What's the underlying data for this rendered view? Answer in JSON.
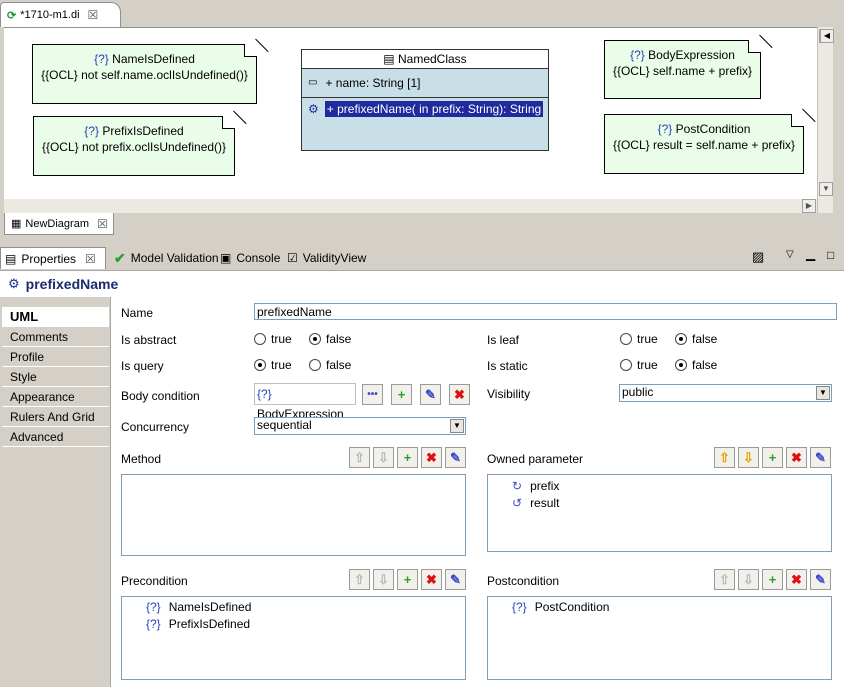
{
  "editor": {
    "tab_label": "*1710-m1.di"
  },
  "diagram": {
    "notes": [
      {
        "title": "NameIsDefined",
        "body": "{{OCL} not self.name.oclIsUndefined()}"
      },
      {
        "title": "PrefixIsDefined",
        "body": "{{OCL} not prefix.oclIsUndefined()}"
      },
      {
        "title": "BodyExpression",
        "body": "{{OCL} self.name + prefix}"
      },
      {
        "title": "PostCondition",
        "body": "{{OCL} result = self.name + prefix}"
      }
    ],
    "class_name": "NamedClass",
    "attribute": "+ name: String [1]",
    "operation": "+ prefixedName(  in prefix: String): String",
    "note_marker": "{?}"
  },
  "diagram_tab": "NewDiagram",
  "views": {
    "properties": "Properties",
    "validation": "Model Validation",
    "console": "Console",
    "validity": "ValidityView"
  },
  "title": "prefixedName",
  "sidebar": [
    "UML",
    "Comments",
    "Profile",
    "Style",
    "Appearance",
    "Rulers And Grid",
    "Advanced"
  ],
  "form": {
    "name_label": "Name",
    "name_value": "prefixedName",
    "is_abstract": "Is abstract",
    "is_leaf": "Is leaf",
    "is_query": "Is query",
    "is_static": "Is static",
    "true": "true",
    "false": "false",
    "body_condition": "Body condition",
    "body_value": "BodyExpression",
    "body_marker": "{?}",
    "visibility": "Visibility",
    "visibility_value": "public",
    "concurrency": "Concurrency",
    "concurrency_value": "sequential",
    "method": "Method",
    "owned_parameter": "Owned parameter",
    "params": [
      "prefix",
      "result"
    ],
    "precondition": "Precondition",
    "preconditions": [
      "NameIsDefined",
      "PrefixIsDefined"
    ],
    "postcondition": "Postcondition",
    "postconditions": [
      "PostCondition"
    ]
  }
}
